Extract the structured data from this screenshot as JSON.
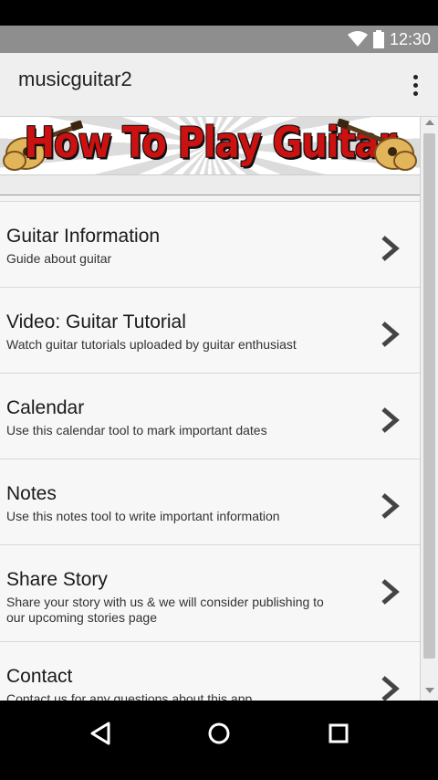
{
  "status_bar": {
    "time": "12:30",
    "icons": [
      "wifi-icon",
      "battery-icon"
    ]
  },
  "app_bar": {
    "title": "musicguitar2",
    "overflow_icon": "more-vertical-icon"
  },
  "banner": {
    "title": "How To Play Guitar"
  },
  "menu": {
    "items": [
      {
        "title": "Guitar Information",
        "description": "Guide about guitar"
      },
      {
        "title": "Video: Guitar Tutorial",
        "description": "Watch guitar tutorials uploaded by guitar enthusiast"
      },
      {
        "title": "Calendar",
        "description": "Use this calendar tool to mark important dates"
      },
      {
        "title": "Notes",
        "description": "Use this notes tool to write important information"
      },
      {
        "title": "Share Story",
        "description": "Share your story with us & we will consider publishing to our upcoming stories page"
      },
      {
        "title": "Contact",
        "description": "Contact us for any questions about this app"
      }
    ]
  },
  "nav_bar": {
    "buttons": [
      "back-icon",
      "home-icon",
      "recents-icon"
    ]
  },
  "colors": {
    "banner_text": "#cc1111",
    "status_bar": "#8e8e8e",
    "app_bar": "#efefef"
  }
}
